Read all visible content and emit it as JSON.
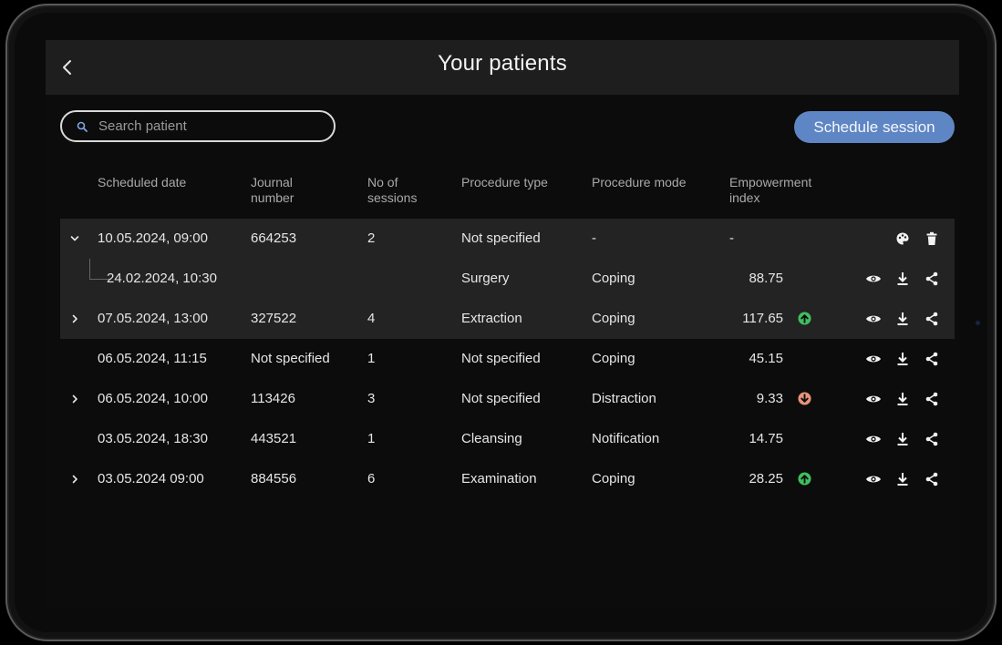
{
  "title": "Your patients",
  "search": {
    "placeholder": "Search patient"
  },
  "schedule_button": "Schedule session",
  "columns": {
    "scheduled_date": "Scheduled date",
    "journal_l1": "Journal",
    "journal_l2": "number",
    "sessions_l1": "No of",
    "sessions_l2": "sessions",
    "procedure_type": "Procedure type",
    "procedure_mode": "Procedure mode",
    "empowerment_l1": "Empowerment",
    "empowerment_l2": "index"
  },
  "rows": [
    {
      "date": "10.05.2024, 09:00",
      "journal": "664253",
      "sessions": "2",
      "type": "Not specified",
      "mode": "-",
      "index": "-",
      "expanded": true
    },
    {
      "date": "24.02.2024, 10:30",
      "journal": "",
      "sessions": "",
      "type": "Surgery",
      "mode": "Coping",
      "index": "88.75",
      "child": true
    },
    {
      "date": "07.05.2024, 13:00",
      "journal": "327522",
      "sessions": "4",
      "type": "Extraction",
      "mode": "Coping",
      "index": "117.65",
      "trend": "up"
    },
    {
      "date": "06.05.2024, 11:15",
      "journal": "Not specified",
      "sessions": "1",
      "type": "Not specified",
      "mode": "Coping",
      "index": "45.15"
    },
    {
      "date": "06.05.2024, 10:00",
      "journal": "113426",
      "sessions": "3",
      "type": "Not specified",
      "mode": "Distraction",
      "index": "9.33",
      "trend": "down"
    },
    {
      "date": "03.05.2024, 18:30",
      "journal": "443521",
      "sessions": "1",
      "type": "Cleansing",
      "mode": "Notification",
      "index": "14.75"
    },
    {
      "date": "03.05.2024  09:00",
      "journal": "884556",
      "sessions": "6",
      "type": "Examination",
      "mode": "Coping",
      "index": "28.25",
      "trend": "up"
    }
  ],
  "colors": {
    "accent": "#5f86c4",
    "trend_up": "#3fbf5f",
    "trend_down": "#e8937a",
    "row_highlight": "#232323",
    "header_bg": "#1e1e1e"
  },
  "icons": [
    "chevron-left-icon",
    "search-icon",
    "chevron-down-icon",
    "chevron-right-icon",
    "arrow-up-circle-icon",
    "arrow-down-circle-icon",
    "eye-icon",
    "download-icon",
    "share-icon",
    "palette-icon",
    "trash-icon"
  ]
}
